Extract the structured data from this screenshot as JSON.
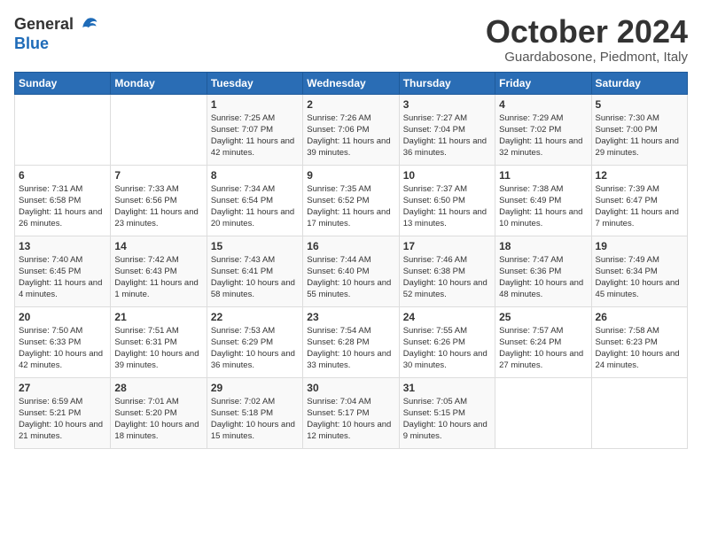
{
  "logo": {
    "general": "General",
    "blue": "Blue"
  },
  "title": "October 2024",
  "subtitle": "Guardabosone, Piedmont, Italy",
  "days_header": [
    "Sunday",
    "Monday",
    "Tuesday",
    "Wednesday",
    "Thursday",
    "Friday",
    "Saturday"
  ],
  "weeks": [
    [
      {
        "day": "",
        "info": ""
      },
      {
        "day": "",
        "info": ""
      },
      {
        "day": "1",
        "info": "Sunrise: 7:25 AM\nSunset: 7:07 PM\nDaylight: 11 hours and 42 minutes."
      },
      {
        "day": "2",
        "info": "Sunrise: 7:26 AM\nSunset: 7:06 PM\nDaylight: 11 hours and 39 minutes."
      },
      {
        "day": "3",
        "info": "Sunrise: 7:27 AM\nSunset: 7:04 PM\nDaylight: 11 hours and 36 minutes."
      },
      {
        "day": "4",
        "info": "Sunrise: 7:29 AM\nSunset: 7:02 PM\nDaylight: 11 hours and 32 minutes."
      },
      {
        "day": "5",
        "info": "Sunrise: 7:30 AM\nSunset: 7:00 PM\nDaylight: 11 hours and 29 minutes."
      }
    ],
    [
      {
        "day": "6",
        "info": "Sunrise: 7:31 AM\nSunset: 6:58 PM\nDaylight: 11 hours and 26 minutes."
      },
      {
        "day": "7",
        "info": "Sunrise: 7:33 AM\nSunset: 6:56 PM\nDaylight: 11 hours and 23 minutes."
      },
      {
        "day": "8",
        "info": "Sunrise: 7:34 AM\nSunset: 6:54 PM\nDaylight: 11 hours and 20 minutes."
      },
      {
        "day": "9",
        "info": "Sunrise: 7:35 AM\nSunset: 6:52 PM\nDaylight: 11 hours and 17 minutes."
      },
      {
        "day": "10",
        "info": "Sunrise: 7:37 AM\nSunset: 6:50 PM\nDaylight: 11 hours and 13 minutes."
      },
      {
        "day": "11",
        "info": "Sunrise: 7:38 AM\nSunset: 6:49 PM\nDaylight: 11 hours and 10 minutes."
      },
      {
        "day": "12",
        "info": "Sunrise: 7:39 AM\nSunset: 6:47 PM\nDaylight: 11 hours and 7 minutes."
      }
    ],
    [
      {
        "day": "13",
        "info": "Sunrise: 7:40 AM\nSunset: 6:45 PM\nDaylight: 11 hours and 4 minutes."
      },
      {
        "day": "14",
        "info": "Sunrise: 7:42 AM\nSunset: 6:43 PM\nDaylight: 11 hours and 1 minute."
      },
      {
        "day": "15",
        "info": "Sunrise: 7:43 AM\nSunset: 6:41 PM\nDaylight: 10 hours and 58 minutes."
      },
      {
        "day": "16",
        "info": "Sunrise: 7:44 AM\nSunset: 6:40 PM\nDaylight: 10 hours and 55 minutes."
      },
      {
        "day": "17",
        "info": "Sunrise: 7:46 AM\nSunset: 6:38 PM\nDaylight: 10 hours and 52 minutes."
      },
      {
        "day": "18",
        "info": "Sunrise: 7:47 AM\nSunset: 6:36 PM\nDaylight: 10 hours and 48 minutes."
      },
      {
        "day": "19",
        "info": "Sunrise: 7:49 AM\nSunset: 6:34 PM\nDaylight: 10 hours and 45 minutes."
      }
    ],
    [
      {
        "day": "20",
        "info": "Sunrise: 7:50 AM\nSunset: 6:33 PM\nDaylight: 10 hours and 42 minutes."
      },
      {
        "day": "21",
        "info": "Sunrise: 7:51 AM\nSunset: 6:31 PM\nDaylight: 10 hours and 39 minutes."
      },
      {
        "day": "22",
        "info": "Sunrise: 7:53 AM\nSunset: 6:29 PM\nDaylight: 10 hours and 36 minutes."
      },
      {
        "day": "23",
        "info": "Sunrise: 7:54 AM\nSunset: 6:28 PM\nDaylight: 10 hours and 33 minutes."
      },
      {
        "day": "24",
        "info": "Sunrise: 7:55 AM\nSunset: 6:26 PM\nDaylight: 10 hours and 30 minutes."
      },
      {
        "day": "25",
        "info": "Sunrise: 7:57 AM\nSunset: 6:24 PM\nDaylight: 10 hours and 27 minutes."
      },
      {
        "day": "26",
        "info": "Sunrise: 7:58 AM\nSunset: 6:23 PM\nDaylight: 10 hours and 24 minutes."
      }
    ],
    [
      {
        "day": "27",
        "info": "Sunrise: 6:59 AM\nSunset: 5:21 PM\nDaylight: 10 hours and 21 minutes."
      },
      {
        "day": "28",
        "info": "Sunrise: 7:01 AM\nSunset: 5:20 PM\nDaylight: 10 hours and 18 minutes."
      },
      {
        "day": "29",
        "info": "Sunrise: 7:02 AM\nSunset: 5:18 PM\nDaylight: 10 hours and 15 minutes."
      },
      {
        "day": "30",
        "info": "Sunrise: 7:04 AM\nSunset: 5:17 PM\nDaylight: 10 hours and 12 minutes."
      },
      {
        "day": "31",
        "info": "Sunrise: 7:05 AM\nSunset: 5:15 PM\nDaylight: 10 hours and 9 minutes."
      },
      {
        "day": "",
        "info": ""
      },
      {
        "day": "",
        "info": ""
      }
    ]
  ]
}
